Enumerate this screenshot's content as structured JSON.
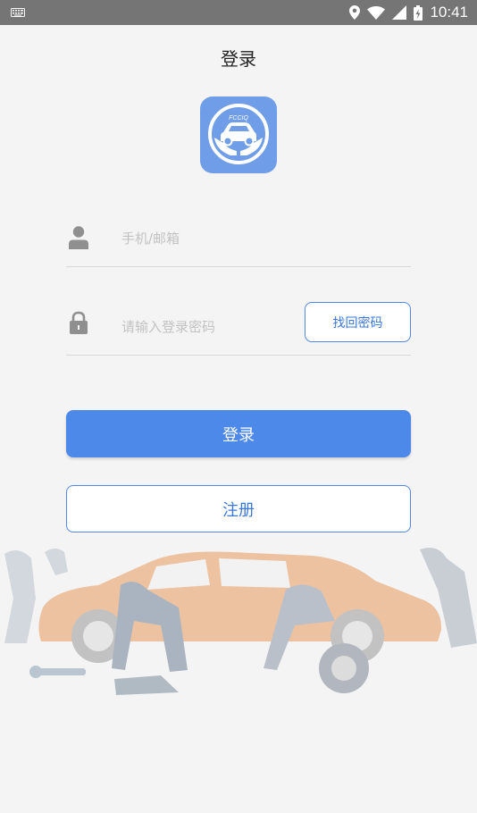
{
  "status_bar": {
    "time": "10:41",
    "icons": [
      "keyboard-icon",
      "location-icon",
      "wifi-icon",
      "signal-icon",
      "battery-charging-icon"
    ]
  },
  "header": {
    "title": "登录"
  },
  "logo": {
    "text": "FCCIQ",
    "icon": "car-in-hands-logo"
  },
  "form": {
    "account_placeholder": "手机/邮箱",
    "password_placeholder": "请输入登录密码",
    "forgot_label": "找回密码"
  },
  "actions": {
    "login_label": "登录",
    "register_label": "注册"
  },
  "colors": {
    "accent": "#4d89e9",
    "logo_bg": "#6f9de8",
    "background": "#f4f4f4",
    "status_bar": "#757575"
  }
}
